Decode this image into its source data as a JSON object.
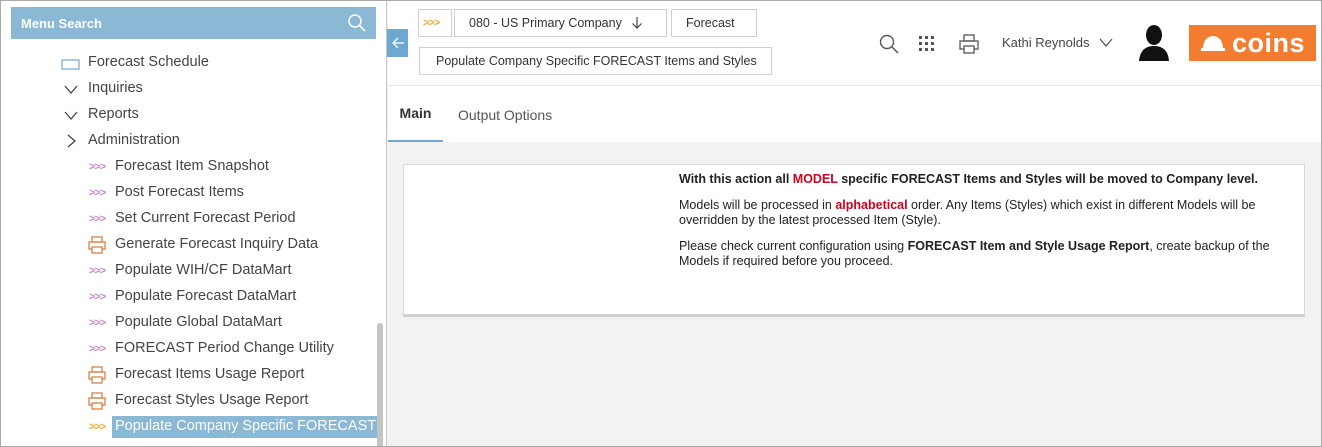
{
  "sidebar": {
    "search_label": "Menu Search",
    "items": [
      {
        "label": "Forecast Schedule",
        "icon": "folder-icon"
      },
      {
        "label": "Inquiries",
        "icon": "chevron-down-icon"
      },
      {
        "label": "Reports",
        "icon": "chevron-down-icon"
      },
      {
        "label": "Administration",
        "icon": "chevron-right-icon"
      },
      {
        "label": "Forecast Item Snapshot",
        "icon": "triple-arrow-icon"
      },
      {
        "label": "Post Forecast Items",
        "icon": "triple-arrow-icon"
      },
      {
        "label": "Set Current Forecast Period",
        "icon": "triple-arrow-icon"
      },
      {
        "label": "Generate Forecast Inquiry Data",
        "icon": "printer-icon"
      },
      {
        "label": "Populate WIH/CF DataMart",
        "icon": "triple-arrow-icon"
      },
      {
        "label": "Populate Forecast DataMart",
        "icon": "triple-arrow-icon"
      },
      {
        "label": "Populate Global DataMart",
        "icon": "triple-arrow-icon"
      },
      {
        "label": "FORECAST Period Change Utility",
        "icon": "triple-arrow-icon"
      },
      {
        "label": "Forecast Items Usage Report",
        "icon": "printer-icon"
      },
      {
        "label": "Forecast Styles Usage Report",
        "icon": "printer-icon"
      },
      {
        "label": "Populate Company Specific FORECAST It",
        "icon": "triple-arrow-icon"
      }
    ]
  },
  "breadcrumb": {
    "home": ">>>",
    "company": "080 - US Primary Company",
    "module": "Forecast",
    "task": "Populate Company Specific FORECAST Items and Styles"
  },
  "header": {
    "user_name": "Kathi Reynolds",
    "logo_text": "coins"
  },
  "tabs": {
    "main": "Main",
    "output": "Output Options"
  },
  "content": {
    "p1": {
      "a": "With this action all ",
      "b": "MODEL",
      "c": " specific FORECAST Items and Styles will be moved to Company level."
    },
    "p2": {
      "a": "Models will be processed in ",
      "b": "alphabetical",
      "c": " order. Any Items (Styles) which exist in different Models will be overridden by the latest processed Item (Style)."
    },
    "p3": {
      "a": "Please check current configuration using ",
      "b": "FORECAST Item and Style Usage Report",
      "c": ", create backup of the Models if required before you proceed."
    }
  },
  "colors": {
    "accent": "#8ab8d5",
    "collapse": "#6ea7cf",
    "brand": "#f47c30",
    "highlight": "#d0021b"
  }
}
